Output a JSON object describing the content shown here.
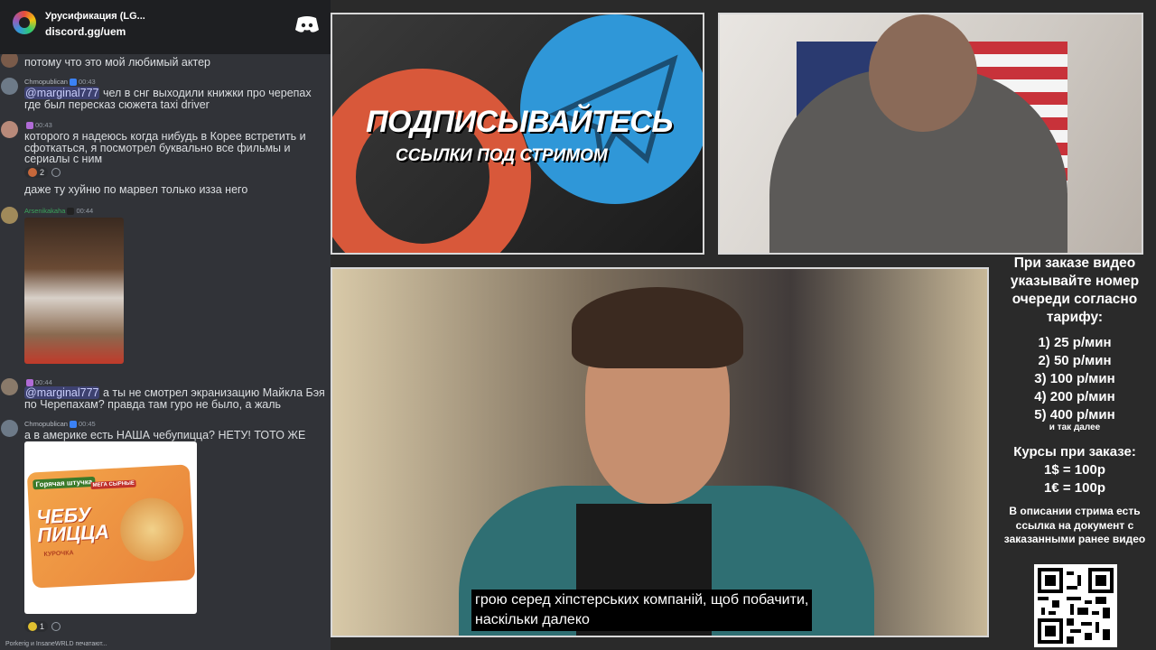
{
  "header": {
    "title": "Урусификация (LG...",
    "link": "discord.gg/uem"
  },
  "messages": [
    {
      "text": "потому что это мой любимый актер"
    },
    {
      "author": "Chmopublican",
      "time": "00:43",
      "mention": "@marginal777",
      "text": " чел в снг выходили книжки про черепах где был пересказ сюжета taxi driver"
    },
    {
      "time": "00:43",
      "text": "которого я надеюсь когда нибудь в Корее встретить и сфоткаться, я посмотрел буквально все фильмы и сериалы с ним",
      "reaction_count": "2"
    },
    {
      "text": "даже ту хуйню по марвел только изза него"
    },
    {
      "author": "Arsenikakaha",
      "time": "00:44"
    },
    {
      "time": "00:44",
      "mention": "@marginal777",
      "text": " а ты не смотрел экранизацию Майкла Бэя по Черепахам? правда там гуро не было, а жаль"
    },
    {
      "author": "Chmopublican",
      "time": "00:45",
      "text": "а в америке есть НАША чебупицца? НЕТУ! ТОТО ЖЕ",
      "reaction_count": "1"
    }
  ],
  "product": {
    "brand": "Горячая штучка",
    "name": "ЧЕБУ ПИЦЦА",
    "flavor": "КУРОЧКА",
    "tag": "МЕГА СЫРНЫЕ"
  },
  "typing": "Porkerig и InsaneWRLD печатают...",
  "promo": {
    "main": "ПОДПИСЫВАЙТЕСЬ",
    "sub": "ССЫЛКИ ПОД СТРИМОМ"
  },
  "subtitle": {
    "line1": "грою серед хіпстерських компаній, щоб побачити,",
    "line2": "наскільки далеко"
  },
  "info": {
    "intro": "При заказе видео указывайте номер очереди согласно тарифу:",
    "tiers": [
      "1) 25 р/мин",
      "2) 50 р/мин",
      "3) 100 р/мин",
      "4) 200 р/мин",
      "5) 400 р/мин"
    ],
    "etc": "и так далее",
    "rates_title": "Курсы при заказе:",
    "rates": [
      "1$ = 100р",
      "1€ = 100р"
    ],
    "desc": "В описании стрима есть ссылка на документ с заказанными ранее видео"
  },
  "colors": {
    "chat_bg": "#313338",
    "header_bg": "#1e1f22",
    "mention": "#c9cdfb",
    "promo_orange": "#d8583a",
    "promo_blue": "#2f97d8"
  }
}
